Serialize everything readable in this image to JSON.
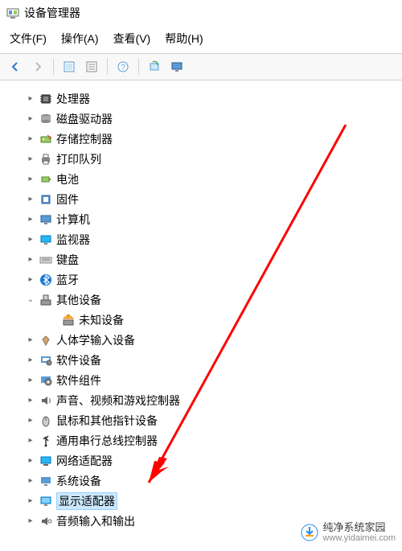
{
  "window": {
    "title": "设备管理器"
  },
  "menu": {
    "file": "文件(F)",
    "action": "操作(A)",
    "view": "查看(V)",
    "help": "帮助(H)"
  },
  "toolbar": {
    "back": "back",
    "forward": "forward",
    "show_hidden": "show-hidden",
    "properties": "properties",
    "refresh": "refresh",
    "scan": "scan",
    "monitor": "monitor"
  },
  "tree": {
    "items": [
      {
        "label": "处理器",
        "icon": "cpu",
        "expander": "▸"
      },
      {
        "label": "磁盘驱动器",
        "icon": "disk",
        "expander": "▸"
      },
      {
        "label": "存储控制器",
        "icon": "storage",
        "expander": "▸"
      },
      {
        "label": "打印队列",
        "icon": "printer",
        "expander": "▸"
      },
      {
        "label": "电池",
        "icon": "battery",
        "expander": "▸"
      },
      {
        "label": "固件",
        "icon": "firmware",
        "expander": "▸"
      },
      {
        "label": "计算机",
        "icon": "computer",
        "expander": "▸"
      },
      {
        "label": "监视器",
        "icon": "monitor",
        "expander": "▸"
      },
      {
        "label": "键盘",
        "icon": "keyboard",
        "expander": "▸"
      },
      {
        "label": "蓝牙",
        "icon": "bluetooth",
        "expander": "▸"
      },
      {
        "label": "其他设备",
        "icon": "other",
        "expander": "⌄"
      },
      {
        "label": "未知设备",
        "icon": "unknown",
        "expander": "",
        "child": true
      },
      {
        "label": "人体学输入设备",
        "icon": "hid",
        "expander": "▸"
      },
      {
        "label": "软件设备",
        "icon": "software",
        "expander": "▸"
      },
      {
        "label": "软件组件",
        "icon": "component",
        "expander": "▸"
      },
      {
        "label": "声音、视频和游戏控制器",
        "icon": "sound",
        "expander": "▸"
      },
      {
        "label": "鼠标和其他指针设备",
        "icon": "mouse",
        "expander": "▸"
      },
      {
        "label": "通用串行总线控制器",
        "icon": "usb",
        "expander": "▸"
      },
      {
        "label": "网络适配器",
        "icon": "network",
        "expander": "▸"
      },
      {
        "label": "系统设备",
        "icon": "system",
        "expander": "▸"
      },
      {
        "label": "显示适配器",
        "icon": "display",
        "expander": "▸",
        "selected": true
      },
      {
        "label": "音频输入和输出",
        "icon": "audio",
        "expander": "▸",
        "cut": true
      }
    ]
  },
  "watermark": {
    "brand": "纯净系统家园",
    "url": "www.yidaimei.com"
  }
}
